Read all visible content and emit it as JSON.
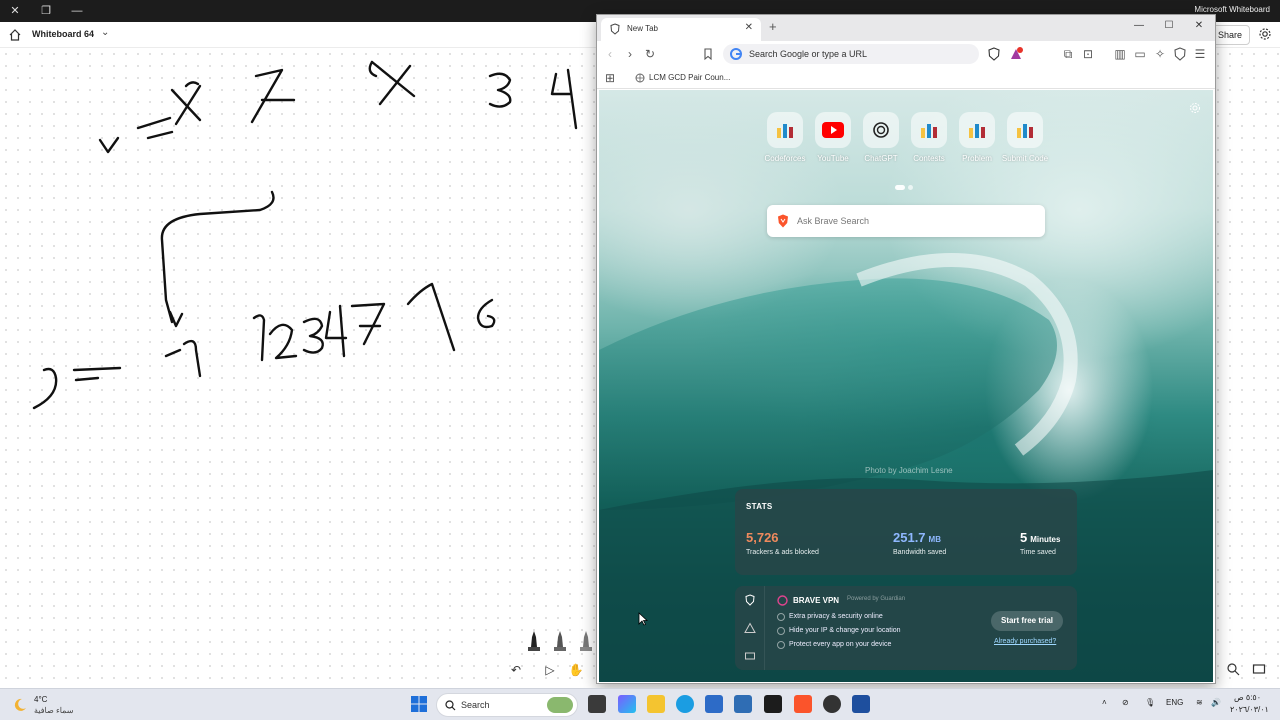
{
  "whiteboard": {
    "app_name": "Microsoft Whiteboard",
    "board_title": "Whiteboard 64",
    "share_label": "Share"
  },
  "browser": {
    "tab_title": "New Tab",
    "address_placeholder": "Search Google or type a URL",
    "bookmark_label": "LCM GCD Pair Coun...",
    "notification_count": "1",
    "top_sites": [
      {
        "label": "Codeforces",
        "icon": "codeforces-icon"
      },
      {
        "label": "YouTube",
        "icon": "youtube-icon"
      },
      {
        "label": "ChatGPT",
        "icon": "chatgpt-icon"
      },
      {
        "label": "Contests",
        "icon": "codeforces-icon"
      },
      {
        "label": "Problem",
        "icon": "codeforces-icon"
      },
      {
        "label": "Submit Code",
        "icon": "codeforces-icon"
      }
    ],
    "search_placeholder": "Ask Brave Search",
    "photo_credit": "Photo by Joachim Lesne",
    "stats": {
      "heading": "STATS",
      "trackers_value": "5,726",
      "trackers_caption": "Trackers & ads blocked",
      "bandwidth_value": "251.7",
      "bandwidth_unit": "MB",
      "bandwidth_caption": "Bandwidth saved",
      "time_value": "5",
      "time_unit": "Minutes",
      "time_caption": "Time saved"
    },
    "vpn": {
      "title": "BRAVE VPN",
      "powered_by": "Powered by Guardian",
      "features": [
        "Extra privacy & security online",
        "Hide your IP & change your location",
        "Protect every app on your device"
      ],
      "cta": "Start free trial",
      "already_link": "Already purchased?"
    }
  },
  "taskbar": {
    "temperature": "4°C",
    "weather_desc": "سماء صافية",
    "search_label": "Search",
    "language": "ENG",
    "time": "٥:٥٠ ص",
    "date": "٢٠٢٦/٠٣/٠١"
  },
  "colors": {
    "trackers": "#f08a5d",
    "bandwidth": "#8fb8ff",
    "time": "#ffffff",
    "brave_orange": "#fb542b"
  }
}
